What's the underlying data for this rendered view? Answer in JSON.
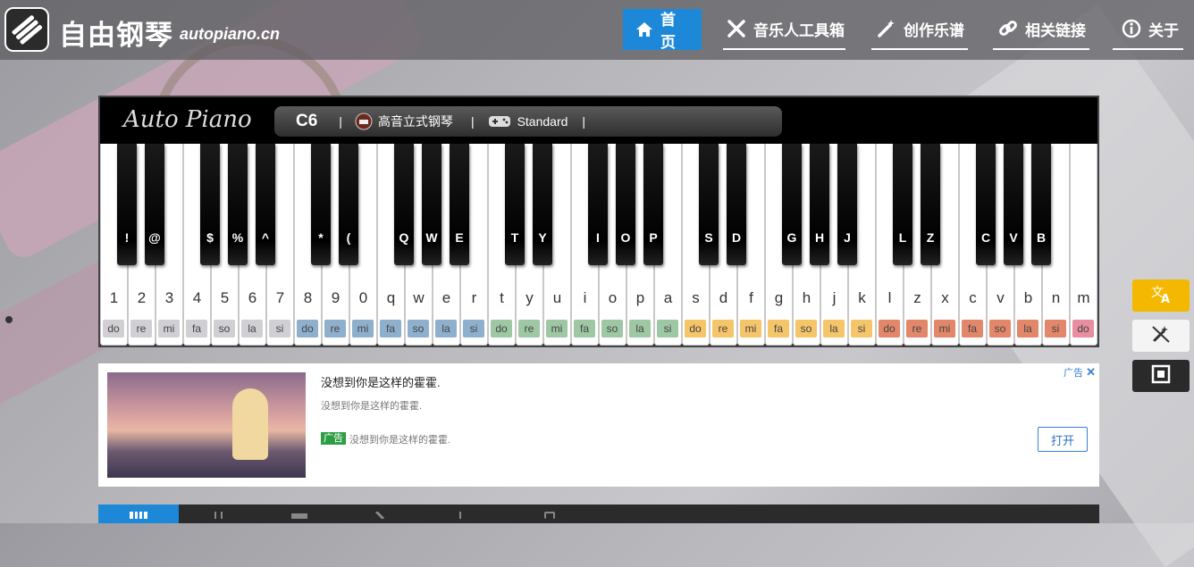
{
  "header": {
    "title": "自由钢琴",
    "domain": "autopiano.cn",
    "nav": [
      {
        "label": "首页",
        "icon": "home-icon"
      },
      {
        "label": "音乐人工具箱",
        "icon": "tools-icon"
      },
      {
        "label": "创作乐谱",
        "icon": "magic-wand-icon"
      },
      {
        "label": "相关链接",
        "icon": "link-icon"
      },
      {
        "label": "关于",
        "icon": "info-icon"
      }
    ]
  },
  "piano": {
    "brand": "Auto Piano",
    "octave": "C6",
    "sep": "|",
    "instrument": "高音立式钢琴",
    "mode": "Standard"
  },
  "keys": {
    "white": [
      "1",
      "2",
      "3",
      "4",
      "5",
      "6",
      "7",
      "8",
      "9",
      "0",
      "q",
      "w",
      "e",
      "r",
      "t",
      "y",
      "u",
      "i",
      "o",
      "p",
      "a",
      "s",
      "d",
      "f",
      "g",
      "h",
      "j",
      "k",
      "l",
      "z",
      "x",
      "c",
      "v",
      "b",
      "n",
      "m"
    ],
    "solfege": [
      "do",
      "re",
      "mi",
      "fa",
      "so",
      "la",
      "si",
      "do",
      "re",
      "mi",
      "fa",
      "so",
      "la",
      "si",
      "do",
      "re",
      "mi",
      "fa",
      "so",
      "la",
      "si",
      "do",
      "re",
      "mi",
      "fa",
      "so",
      "la",
      "si",
      "do",
      "re",
      "mi",
      "fa",
      "so",
      "la",
      "si",
      "do"
    ],
    "black": [
      "!",
      "@",
      "$",
      "%",
      "^",
      "*",
      "(",
      "Q",
      "W",
      "E",
      "T",
      "Y",
      "I",
      "O",
      "P",
      "S",
      "D",
      "G",
      "H",
      "J",
      "L",
      "Z",
      "C",
      "V",
      "B"
    ]
  },
  "colors": {
    "octave_fills": [
      "#d0d0d4",
      "#8fb0cc",
      "#9ec7a4",
      "#f5c56a",
      "#e3876a"
    ],
    "last_key_fill": "#e88ea0",
    "accent": "#1e88d8",
    "translate_btn": "#f5b800"
  },
  "ad": {
    "title": "没想到你是这样的霍霍.",
    "desc": "没想到你是这样的霍霍.",
    "tag": "广告",
    "line": "没想到你是这样的霍霍.",
    "button": "打开",
    "corner": "广告"
  },
  "side_buttons": [
    "translate-icon",
    "no-magic-icon",
    "fullscreen-icon"
  ]
}
